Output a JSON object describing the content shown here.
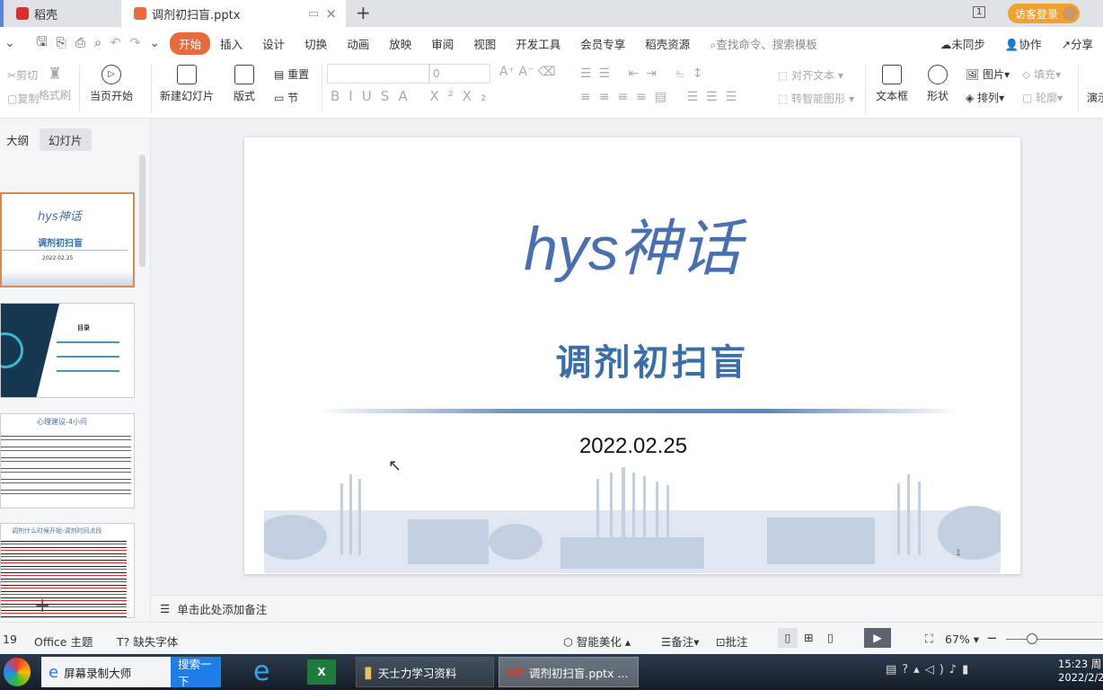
{
  "tabs": [
    {
      "label": "稻壳"
    },
    {
      "label": "调剂初扫盲.pptx"
    }
  ],
  "window": {
    "badge": "1",
    "login": "访客登录"
  },
  "menu": {
    "items": [
      "开始",
      "插入",
      "设计",
      "切换",
      "动画",
      "放映",
      "审阅",
      "视图",
      "开发工具",
      "会员专享",
      "稻壳资源"
    ],
    "search_placeholder": "查找命令、搜索模板",
    "sync": "未同步",
    "collab": "协作",
    "share": "分享"
  },
  "ribbon": {
    "cut": "剪切",
    "copy": "复制",
    "format_painter": "格式刷",
    "play_current": "当页开始",
    "new_slide": "新建幻灯片",
    "layout": "版式",
    "reset": "重置",
    "section": "节",
    "font_size": "0",
    "align_text": "对齐文本",
    "smart_shape": "转智能图形",
    "textbox": "文本框",
    "shape": "形状",
    "picture": "图片",
    "arrange": "排列",
    "fill": "填充",
    "outline": "轮廓",
    "present": "演示"
  },
  "left": {
    "tab_outline": "大纲",
    "tab_slides": "幻灯片",
    "thumbs": [
      {
        "title": "hys神话",
        "subtitle": "调剂初扫盲",
        "date": "2022.02.25"
      },
      {
        "title": "目录"
      },
      {
        "title": "心理建设-4小问"
      },
      {
        "title": "调剂什么时候开始-调剂时间点段"
      }
    ],
    "add": "+"
  },
  "slide": {
    "title": "hys神话",
    "subtitle": "调剂初扫盲",
    "date": "2022.02.25",
    "page": "1",
    "accent": "#4a6fb0",
    "subtitle_color": "#3a6ea8"
  },
  "notes": {
    "placeholder": "单击此处添加备注"
  },
  "status": {
    "slide_count": "19",
    "theme": "Office 主题",
    "missing_font": "缺失字体",
    "beautify": "智能美化",
    "notes": "备注",
    "comments": "批注",
    "zoom": "67%",
    "zoom_level": 67
  },
  "taskbar": {
    "recorder": "屏幕录制大师",
    "search": "搜索一下",
    "folder": "天士力学习资料",
    "ppt": "调剂初扫盲.pptx ...",
    "time": "15:23 周",
    "date": "2022/2/2"
  }
}
